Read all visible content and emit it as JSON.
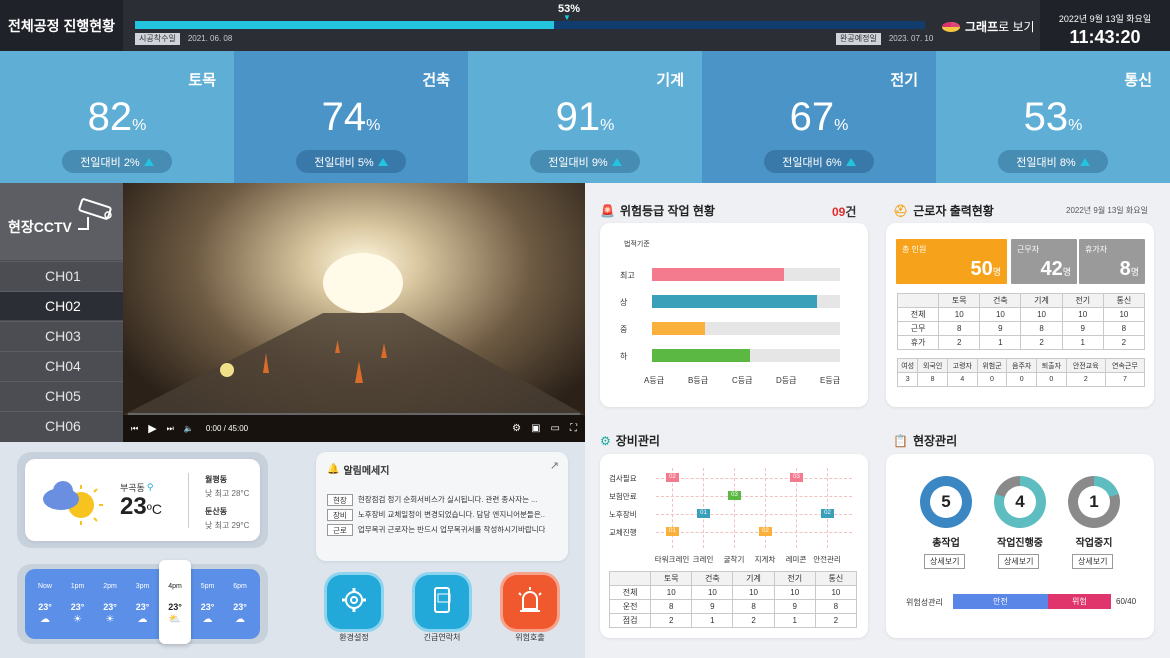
{
  "header": {
    "title": "전체공정 진행현황",
    "progress_pct_label": "53%",
    "progress": 0.53,
    "start_label": "시공착수일",
    "start_date": "2021. 06. 08",
    "end_label": "완공예정일",
    "end_date": "2023. 07. 10",
    "graph_btn_bold": "그래프",
    "graph_btn_rest": "로 보기",
    "date": "2022년 9월 13일 화요일",
    "time": "11:43:20"
  },
  "tiles": [
    {
      "name": "토목",
      "pct": "82",
      "unit": "%",
      "compare": "전일대비 2%",
      "color": "#5faed5",
      "icon": "excavator-icon"
    },
    {
      "name": "건축",
      "pct": "74",
      "unit": "%",
      "compare": "전일대비 5%",
      "color": "#4b94c8",
      "icon": "crane-icon"
    },
    {
      "name": "기계",
      "pct": "91",
      "unit": "%",
      "compare": "전일대비 9%",
      "color": "#5faed5",
      "icon": "gear-wrench-icon"
    },
    {
      "name": "전기",
      "pct": "67",
      "unit": "%",
      "compare": "전일대비 6%",
      "color": "#4b94c8",
      "icon": "power-tower-icon"
    },
    {
      "name": "통신",
      "pct": "53",
      "unit": "%",
      "compare": "전일대비 8%",
      "color": "#5faed5",
      "icon": "antenna-icon"
    }
  ],
  "cctv": {
    "title": "현장CCTV",
    "channels": [
      "CH01",
      "CH02",
      "CH03",
      "CH04",
      "CH05",
      "CH06"
    ],
    "active": "CH02",
    "time": "0:00 / 45:00"
  },
  "risk": {
    "title": "위험등급 작업 현황",
    "count": "09",
    "count_unit": "건",
    "axis_label": "법적기준"
  },
  "chart_data": {
    "type": "bar",
    "orientation": "horizontal",
    "categories": [
      "최고",
      "상",
      "중",
      "하"
    ],
    "values": [
      70,
      88,
      28,
      52
    ],
    "colors": [
      "#f47a8e",
      "#3a9fb8",
      "#fbb03b",
      "#5bb843"
    ],
    "xlim": [
      0,
      100
    ],
    "x_tick_labels": [
      "A등급",
      "B등급",
      "C등급",
      "D등급",
      "E등급"
    ],
    "ylabel": "법적기준"
  },
  "workers": {
    "title": "근로자 출력현황",
    "date": "2022년 9월 13일 화요일",
    "total_label": "총 인원",
    "total": "50",
    "unit": "명",
    "working_label": "근무자",
    "working": "42",
    "leave_label": "휴가자",
    "leave": "8",
    "table_header": [
      "",
      "토목",
      "건축",
      "기계",
      "전기",
      "통신"
    ],
    "table_rows": [
      [
        "전체",
        "10",
        "10",
        "10",
        "10",
        "10"
      ],
      [
        "근무",
        "8",
        "9",
        "8",
        "9",
        "8"
      ],
      [
        "휴가",
        "2",
        "1",
        "2",
        "1",
        "2"
      ]
    ],
    "sub_header": [
      "여성",
      "외국인",
      "고령자",
      "위험군",
      "음주자",
      "퇴출자",
      "안전교육",
      "연속근무"
    ],
    "sub_values": [
      "3",
      "8",
      "4",
      "0",
      "0",
      "0",
      "2",
      "7"
    ]
  },
  "equipment": {
    "title": "장비관리",
    "rows": [
      "검사필요",
      "보험만료",
      "노후장비",
      "교체진행"
    ],
    "cols": [
      "타워크레인",
      "크레인",
      "굴착기",
      "지게차",
      "레미콘",
      "안전관리"
    ],
    "markers": [
      {
        "label": "02",
        "row": 0,
        "col": 0,
        "color": "#f47a8e"
      },
      {
        "label": "03",
        "row": 0,
        "col": 4,
        "color": "#f47a8e"
      },
      {
        "label": "03",
        "row": 1,
        "col": 2,
        "color": "#5bb843"
      },
      {
        "label": "01",
        "row": 2,
        "col": 1,
        "color": "#3a9fb8"
      },
      {
        "label": "02",
        "row": 2,
        "col": 5,
        "color": "#3a9fb8"
      },
      {
        "label": "01",
        "row": 3,
        "col": 0,
        "color": "#fbb03b"
      },
      {
        "label": "02",
        "row": 3,
        "col": 3,
        "color": "#fbb03b"
      }
    ],
    "table_header": [
      "",
      "토목",
      "건축",
      "기계",
      "전기",
      "통신"
    ],
    "table_rows": [
      [
        "전체",
        "10",
        "10",
        "10",
        "10",
        "10"
      ],
      [
        "운전",
        "8",
        "9",
        "8",
        "9",
        "8"
      ],
      [
        "점검",
        "2",
        "1",
        "2",
        "1",
        "2"
      ]
    ]
  },
  "site": {
    "title": "현장관리",
    "items": [
      {
        "value": "5",
        "label": "총작업",
        "btn": "상세보기",
        "ratio": 1.0,
        "color": "#3b87c4"
      },
      {
        "value": "4",
        "label": "작업진행중",
        "btn": "상세보기",
        "ratio": 0.8,
        "color": "#5dbdc0"
      },
      {
        "value": "1",
        "label": "작업중지",
        "btn": "상세보기",
        "ratio": 0.2,
        "color": "#5dbdc0"
      }
    ],
    "risk_label": "위험성관리",
    "safe_label": "안전",
    "danger_label": "위험",
    "safe_ratio": 0.6,
    "ratio_text": "60/40"
  },
  "weather": {
    "location": "부곡동",
    "temp": "23",
    "temp_unit": "ºC",
    "side1_name": "월평동",
    "side1_detail": "낮 최고 28°C",
    "side2_name": "둔산동",
    "side2_detail": "낮 최고 29°C",
    "hours": [
      {
        "time": "Now",
        "temp": "23°",
        "icon": "rain-icon"
      },
      {
        "time": "1pm",
        "temp": "23°",
        "icon": "sun-icon"
      },
      {
        "time": "2pm",
        "temp": "23°",
        "icon": "sun-icon"
      },
      {
        "time": "3pm",
        "temp": "23°",
        "icon": "rain-icon"
      },
      {
        "time": "4pm",
        "temp": "23°",
        "icon": "partly-cloudy-icon"
      },
      {
        "time": "5pm",
        "temp": "23°",
        "icon": "rain-icon"
      },
      {
        "time": "6pm",
        "temp": "23°",
        "icon": "rain-icon"
      }
    ],
    "active_hour": 4
  },
  "notice": {
    "title": "알림메세지",
    "rows": [
      {
        "tag": "현장",
        "text": "현장점검 정기 순회서비스가 실시됩니다. 관련 종사자는 ..."
      },
      {
        "tag": "장비",
        "text": "노후장비 교체일정이 변경되었습니다. 담당 엔지니어분들은..."
      },
      {
        "tag": "근로",
        "text": "업무복귀 근로자는 반드시 업무복귀서를 작성하시기바랍니다."
      }
    ]
  },
  "actions": [
    {
      "label": "환경설정",
      "color": "#22a9d9"
    },
    {
      "label": "긴급연락처",
      "color": "#22a9d9"
    },
    {
      "label": "위험호출",
      "color": "#f0582e"
    }
  ]
}
